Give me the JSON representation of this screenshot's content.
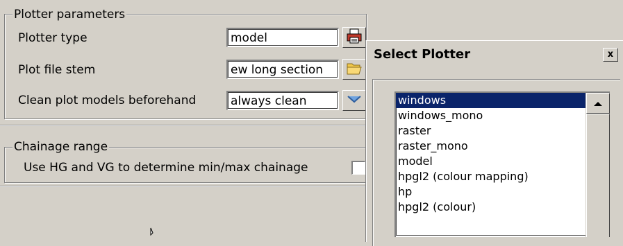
{
  "plotter_group": {
    "legend": "Plotter parameters",
    "plotter_type_label": "Plotter type",
    "plotter_type_value": "model",
    "plot_file_stem_label": "Plot file stem",
    "plot_file_stem_value": "ew long section",
    "clean_label": "Clean plot models beforehand",
    "clean_value": "always clean"
  },
  "chainage_group": {
    "legend": "Chainage range",
    "use_hg_label": "Use HG and VG to determine min/max chainage",
    "use_hg_checked": false
  },
  "dialog": {
    "title": "Select Plotter",
    "close_label": "x",
    "items": [
      {
        "label": "windows",
        "selected": true
      },
      {
        "label": "windows_mono",
        "selected": false
      },
      {
        "label": "raster",
        "selected": false
      },
      {
        "label": "raster_mono",
        "selected": false
      },
      {
        "label": "model",
        "selected": false
      },
      {
        "label": "hpgl2 (colour mapping)",
        "selected": false
      },
      {
        "label": "hp",
        "selected": false
      },
      {
        "label": "hpgl2 (colour)",
        "selected": false
      }
    ]
  },
  "icons": {
    "plotter": "printer-icon",
    "folder": "folder-icon",
    "dropdown": "chevron-down-icon",
    "scroll_up": "arrow-up-icon"
  },
  "colors": {
    "background": "#d4d0c8",
    "selection": "#0a246a"
  }
}
